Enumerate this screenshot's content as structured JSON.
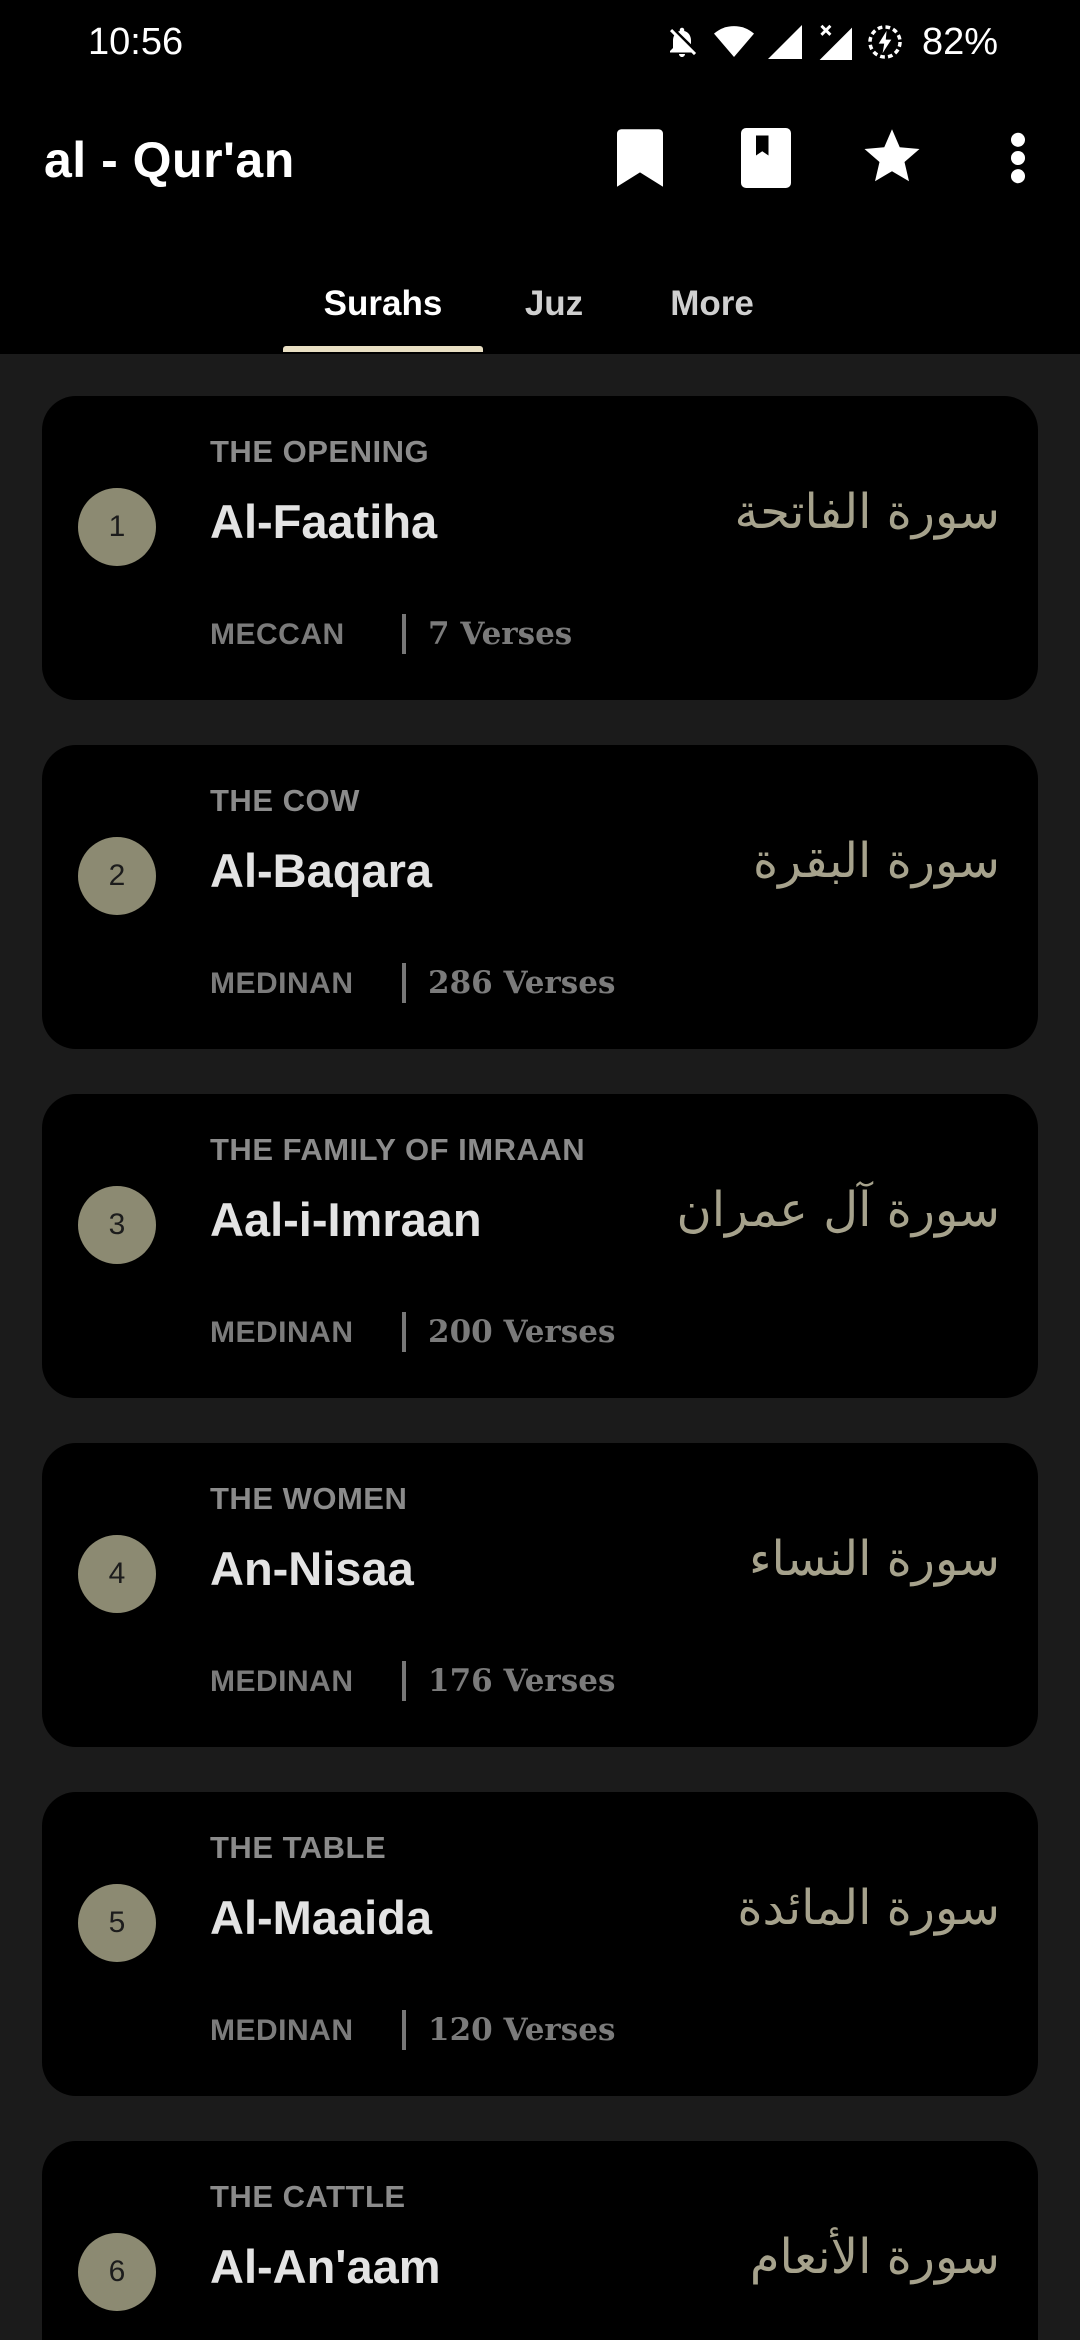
{
  "status_bar": {
    "time": "10:56",
    "icons": [
      "notifications-off-icon",
      "wifi-icon",
      "signal-icon",
      "signal-no-data-icon",
      "battery-saver-icon"
    ],
    "battery": "82%"
  },
  "app_bar": {
    "title": "al - Qur'an",
    "actions": [
      "bookmark-icon",
      "book-icon",
      "star-icon",
      "more-vert-icon"
    ]
  },
  "tabs": [
    {
      "label": "Surahs",
      "active": true
    },
    {
      "label": "Juz",
      "active": false
    },
    {
      "label": "More",
      "active": false
    }
  ],
  "surahs": [
    {
      "number": "1",
      "meaning": "THE OPENING",
      "name": "Al-Faatiha",
      "arabic": "سورة الفاتحة",
      "revelation": "MECCAN",
      "verses": "7 Verses"
    },
    {
      "number": "2",
      "meaning": "THE COW",
      "name": "Al-Baqara",
      "arabic": "سورة البقرة",
      "revelation": "MEDINAN",
      "verses": "286 Verses"
    },
    {
      "number": "3",
      "meaning": "THE FAMILY OF IMRAAN",
      "name": "Aal-i-Imraan",
      "arabic": "سورة آل عمران",
      "revelation": "MEDINAN",
      "verses": "200 Verses"
    },
    {
      "number": "4",
      "meaning": "THE WOMEN",
      "name": "An-Nisaa",
      "arabic": "سورة النساء",
      "revelation": "MEDINAN",
      "verses": "176 Verses"
    },
    {
      "number": "5",
      "meaning": "THE TABLE",
      "name": "Al-Maaida",
      "arabic": "سورة المائدة",
      "revelation": "MEDINAN",
      "verses": "120 Verses"
    },
    {
      "number": "6",
      "meaning": "THE CATTLE",
      "name": "Al-An'aam",
      "arabic": "سورة الأنعام",
      "revelation": "",
      "verses": ""
    }
  ],
  "colors": {
    "background": "#1b1b1b",
    "card": "#000000",
    "number_badge": "#8c8a72",
    "tab_indicator": "#e9dfc3",
    "arabic_text": "#a6a28c"
  }
}
